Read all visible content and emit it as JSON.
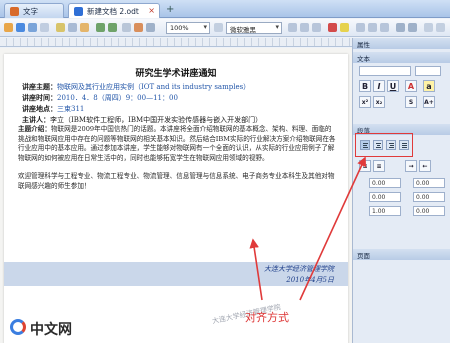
{
  "tabs": [
    {
      "label": "文字"
    },
    {
      "label": "新建文档 2.odt"
    }
  ],
  "toolbar": {
    "zoom": "100%",
    "font": "微软雅黑"
  },
  "document": {
    "title": "研究生学术讲座通知",
    "rows": [
      {
        "label": "讲座主题：",
        "value": "物联网及其行业应用实例（IOT and its industry samples）"
      },
      {
        "label": "讲座时间：",
        "value": "2010．4．8（周四）9：00—11：00"
      },
      {
        "label": "讲座地点：",
        "value": "三束311"
      },
      {
        "label": "主讲人：",
        "value": "李立（IBM软件工程师，IBM中国开发实验传感器与嵌入开发部门）"
      }
    ],
    "intro_label": "主题介绍：",
    "intro": "物联网是2009年中国信热门的话题。本讲座将全面介绍物联网的基本概念、架构、料理、面临的挑战和物联网应用中存在的问题等物联网的相关基本知识。然后结合IBM实际的行业解决方案介绍物联网在各行业应用中的基本应用。通过参加本讲座，学生能够对物联网有一个全面的认识，从实际的行业应用例子了解物联网的如何被应用在日常生活中的，同时也能够拓宽学生在物联网应用领域的视野。",
    "audience": "欢迎管理科学与工程专业、物流工程专业、物流管理、信息管理与信息系统、电子商务专业本科生及其他对物联网感兴趣的师生参加！",
    "sign_org": "大连大学经济管理学院",
    "sign_date": "2010年4月5日"
  },
  "panel": {
    "title": "属性",
    "section_text": "文本",
    "section_para": "段落",
    "section_pages": "页面"
  },
  "watermark": "大连大学经济管理学院",
  "annotation": "对齐方式",
  "logo": {
    "text": "中文网",
    "prefix": "php"
  },
  "colors": {
    "annotation": "#e03a3a",
    "accent": "#2155a8"
  }
}
